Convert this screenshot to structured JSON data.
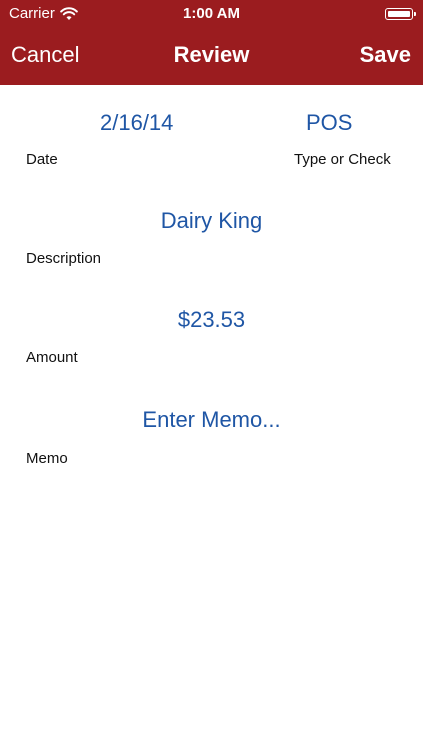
{
  "status_bar": {
    "carrier": "Carrier",
    "time": "1:00 AM",
    "icons": [
      "wifi-icon",
      "battery-icon"
    ]
  },
  "nav": {
    "left_button": "Cancel",
    "title": "Review",
    "right_button": "Save"
  },
  "form": {
    "date_value": "2/16/14",
    "date_label": "Date",
    "type_value": "POS",
    "type_label": "Type or Check",
    "description_value": "Dairy King",
    "description_label": "Description",
    "amount_value": "$23.53",
    "amount_label": "Amount",
    "memo_placeholder": "Enter Memo...",
    "memo_label": "Memo"
  },
  "colors": {
    "nav_background": "#9b1c1f",
    "value_text": "#1f56a5",
    "label_text": "#111111"
  }
}
